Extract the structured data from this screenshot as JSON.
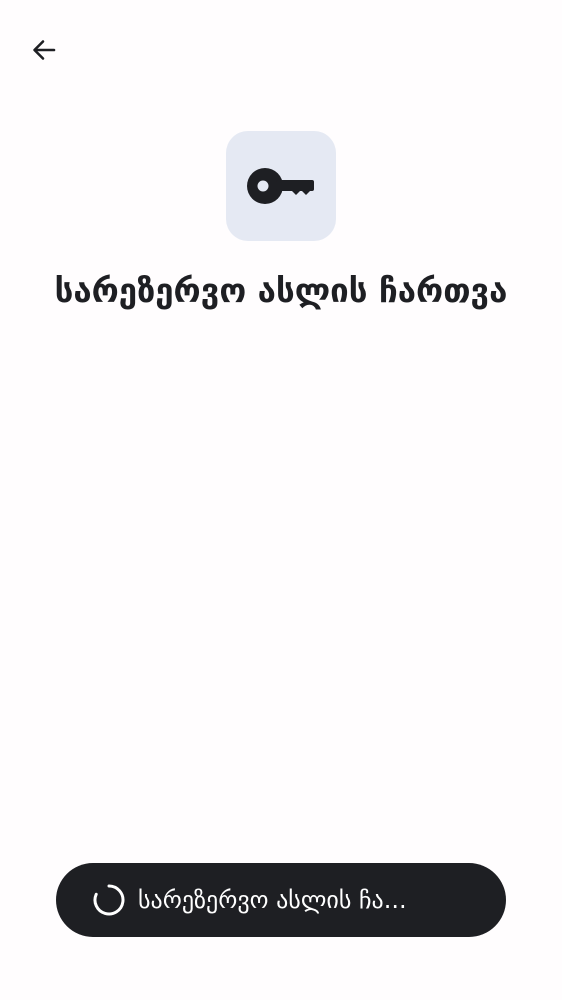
{
  "header": {
    "back_icon": "arrow-left-icon"
  },
  "hero": {
    "icon": "key-icon",
    "icon_background": "#e5e9f3",
    "icon_color": "#1e1f23"
  },
  "title": "სარეზერვო ასლის ჩართვა",
  "primary_button": {
    "label": "სარეზერვო ასლის ჩა...",
    "state": "loading",
    "spinner_icon": "loading-spinner-icon",
    "background": "#1e1f23",
    "text_color": "#ffffff"
  }
}
